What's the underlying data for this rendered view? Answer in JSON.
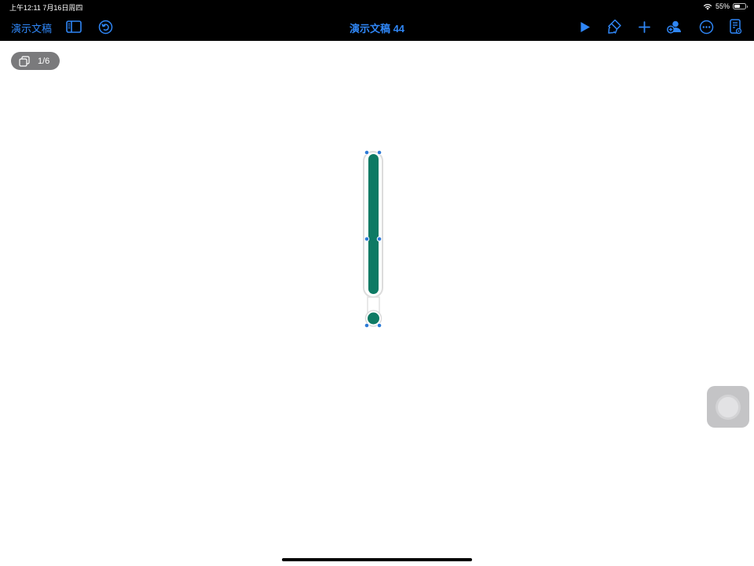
{
  "status_bar": {
    "time_date": "上午12:11   7月16日周四",
    "battery": "55%",
    "battery_level": 0.55
  },
  "toolbar": {
    "back_label": "演示文稿",
    "title": "演示文稿 44",
    "accent_color": "#2f86f6"
  },
  "slide_counter": {
    "label": "1/6"
  },
  "shape": {
    "fill_color": "#0e7a64",
    "handle_color": "#2e7bd6"
  },
  "icons": [
    "sidebar-icon",
    "undo-icon",
    "play-icon",
    "format-brush-icon",
    "add-icon",
    "collaborate-icon",
    "more-icon",
    "document-options-icon",
    "slides-icon",
    "wifi-icon",
    "battery-icon"
  ]
}
